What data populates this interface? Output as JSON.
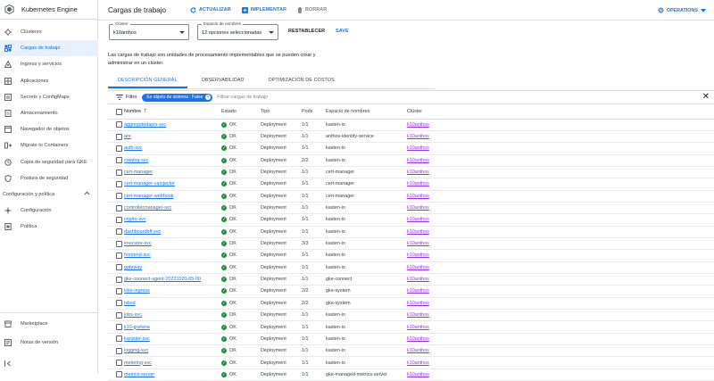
{
  "sidebar": {
    "title": "Kubernetes Engine",
    "items": [
      {
        "label": "Clústeres",
        "icon": "clusters-icon"
      },
      {
        "label": "Cargas de trabajo",
        "icon": "workloads-icon"
      },
      {
        "label": "Ingress y servicios",
        "icon": "services-icon"
      },
      {
        "label": "Aplicaciones",
        "icon": "applications-icon"
      },
      {
        "label": "Secrets y ConfigMaps",
        "icon": "secrets-icon"
      },
      {
        "label": "Almacenamiento",
        "icon": "storage-icon"
      },
      {
        "label": "Navegador de objetos",
        "icon": "object-browser-icon"
      },
      {
        "label": "Migrate to Containers",
        "icon": "migrate-icon"
      },
      {
        "label": "Copia de seguridad para GKE",
        "icon": "backup-icon"
      },
      {
        "label": "Postura de seguridad",
        "icon": "security-posture-icon"
      }
    ],
    "section": {
      "label": "Configuración y política"
    },
    "section_items": [
      {
        "label": "Configuración",
        "icon": "config-icon"
      },
      {
        "label": "Política",
        "icon": "policy-icon"
      }
    ],
    "bottom_items": [
      {
        "label": "Marketplace",
        "icon": "marketplace-icon"
      },
      {
        "label": "Notas de versión",
        "icon": "release-notes-icon"
      }
    ]
  },
  "header": {
    "title": "Cargas de trabajo",
    "refresh_label": "ACTUALIZAR",
    "deploy_label": "IMPLEMENTAR",
    "delete_label": "BORRAR",
    "operations_label": "OPERATIONS"
  },
  "filters": {
    "cluster_label": "Clúster",
    "cluster_value": "k10anthos",
    "namespace_label": "Espacio de nombres",
    "namespace_value": "12 opciones seleccionadas",
    "reset_label": "RESTABLECER",
    "save_label": "SAVE"
  },
  "description": "Las cargas de trabajo son unidades de procesamiento implementables que se pueden crear y administrar en un clúster.",
  "tabs": [
    "DESCRIPCIÓN GENERAL",
    "OBSERVABILIDAD",
    "OPTIMIZACIÓN DE COSTOS"
  ],
  "filter_bar": {
    "label": "Filtro",
    "chip": "Es objeto de sistema : False",
    "placeholder": "Filtrar cargas de trabajo"
  },
  "table": {
    "headers": [
      "Nombre",
      "Estado",
      "Tipo",
      "Pods",
      "Espacio de nombres",
      "Clúster"
    ],
    "rows": [
      {
        "name": "aggregatedapis-svc",
        "state": "OK",
        "type": "Deployment",
        "pods": "1/1",
        "ns": "kasten-io",
        "cluster": "k10anthos"
      },
      {
        "name": "are",
        "state": "OK",
        "type": "Deployment",
        "pods": "1/1",
        "ns": "anthos-identity-service",
        "cluster": "k10anthos"
      },
      {
        "name": "auth-svc",
        "state": "OK",
        "type": "Deployment",
        "pods": "1/1",
        "ns": "kasten-io",
        "cluster": "k10anthos"
      },
      {
        "name": "catalog-svc",
        "state": "OK",
        "type": "Deployment",
        "pods": "2/2",
        "ns": "kasten-io",
        "cluster": "k10anthos"
      },
      {
        "name": "cert-manager",
        "state": "OK",
        "type": "Deployment",
        "pods": "1/1",
        "ns": "cert-manager",
        "cluster": "k10anthos"
      },
      {
        "name": "cert-manager-cainjector",
        "state": "OK",
        "type": "Deployment",
        "pods": "1/1",
        "ns": "cert-manager",
        "cluster": "k10anthos"
      },
      {
        "name": "cert-manager-webhook",
        "state": "OK",
        "type": "Deployment",
        "pods": "1/1",
        "ns": "cert-manager",
        "cluster": "k10anthos"
      },
      {
        "name": "controllermanager-svc",
        "state": "OK",
        "type": "Deployment",
        "pods": "1/1",
        "ns": "kasten-io",
        "cluster": "k10anthos"
      },
      {
        "name": "crypto-svc",
        "state": "OK",
        "type": "Deployment",
        "pods": "1/1",
        "ns": "kasten-io",
        "cluster": "k10anthos"
      },
      {
        "name": "dashboardbff-svc",
        "state": "OK",
        "type": "Deployment",
        "pods": "1/1",
        "ns": "kasten-io",
        "cluster": "k10anthos"
      },
      {
        "name": "executor-svc",
        "state": "OK",
        "type": "Deployment",
        "pods": "3/3",
        "ns": "kasten-io",
        "cluster": "k10anthos"
      },
      {
        "name": "frontend-svc",
        "state": "OK",
        "type": "Deployment",
        "pods": "1/1",
        "ns": "kasten-io",
        "cluster": "k10anthos"
      },
      {
        "name": "gateway",
        "state": "OK",
        "type": "Deployment",
        "pods": "1/1",
        "ns": "kasten-io",
        "cluster": "k10anthos"
      },
      {
        "name": "gke-connect-agent-20221020-05-00",
        "state": "OK",
        "type": "Deployment",
        "pods": "1/1",
        "ns": "gke-connect",
        "cluster": "k10anthos"
      },
      {
        "name": "istio-ingress",
        "state": "OK",
        "type": "Deployment",
        "pods": "2/2",
        "ns": "gke-system",
        "cluster": "k10anthos"
      },
      {
        "name": "istiod",
        "state": "OK",
        "type": "Deployment",
        "pods": "2/2",
        "ns": "gke-system",
        "cluster": "k10anthos"
      },
      {
        "name": "jobs-svc",
        "state": "OK",
        "type": "Deployment",
        "pods": "1/1",
        "ns": "kasten-io",
        "cluster": "k10anthos"
      },
      {
        "name": "k10-grafana",
        "state": "OK",
        "type": "Deployment",
        "pods": "1/1",
        "ns": "kasten-io",
        "cluster": "k10anthos"
      },
      {
        "name": "kanister-svc",
        "state": "OK",
        "type": "Deployment",
        "pods": "1/1",
        "ns": "kasten-io",
        "cluster": "k10anthos"
      },
      {
        "name": "logging-svc",
        "state": "OK",
        "type": "Deployment",
        "pods": "1/1",
        "ns": "kasten-io",
        "cluster": "k10anthos"
      },
      {
        "name": "metering-svc",
        "state": "OK",
        "type": "Deployment",
        "pods": "1/1",
        "ns": "kasten-io",
        "cluster": "k10anthos"
      },
      {
        "name": "metrics-server",
        "state": "OK",
        "type": "Deployment",
        "pods": "1/1",
        "ns": "gke-managed-metrics-server",
        "cluster": "k10anthos"
      }
    ]
  },
  "colors": {
    "accent": "#1a73e8",
    "ok": "#1e8e3e",
    "cluster_link": "#9334e6",
    "active_bg": "#e8f0fe"
  }
}
